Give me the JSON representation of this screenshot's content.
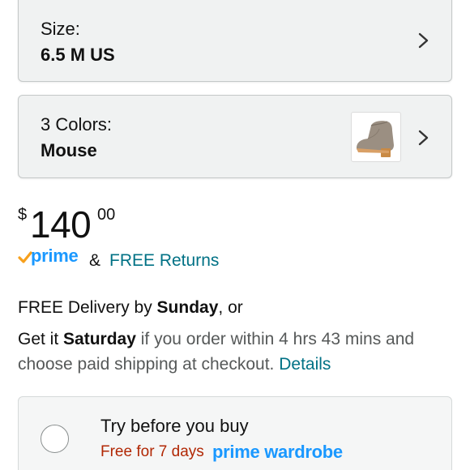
{
  "size_selector": {
    "label": "Size:",
    "value": "6.5 M US"
  },
  "color_selector": {
    "label": "3 Colors:",
    "value": "Mouse",
    "thumbnail_icon": "boot-thumbnail"
  },
  "price": {
    "currency": "$",
    "whole": "140",
    "fraction": "00"
  },
  "prime": {
    "label": "prime",
    "amp": "&",
    "returns_link": "FREE Returns",
    "brand_color": "#1a98ff",
    "check_color": "#f7a01c"
  },
  "delivery": {
    "line1_prefix": "FREE Delivery by ",
    "line1_day": "Sunday",
    "line1_suffix": ", or",
    "line2_prefix": "Get it ",
    "line2_day": "Saturday",
    "line2_middle": " if you order within 4 hrs 43 mins and choose paid shipping at checkout. ",
    "details_link": "Details"
  },
  "try_before_buy": {
    "title": "Try before you buy",
    "free_text": "Free for 7 days",
    "brand": "prime wardrobe"
  },
  "colors": {
    "link": "#007185",
    "deal_red": "#b12704"
  }
}
